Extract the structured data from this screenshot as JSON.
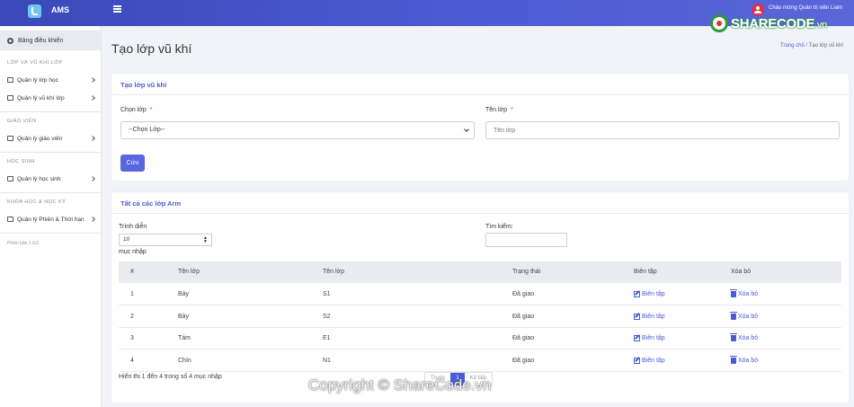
{
  "header": {
    "brand": "AMS",
    "welcome": "Chào mừng Quản trị viên Liam"
  },
  "sidebar": {
    "dashboard": "Bảng điều khiển",
    "sections": [
      {
        "title": "LỚP VÀ VŨ KHÍ LỚP",
        "items": [
          "Quản lý lớp học",
          "Quản lý vũ khí lớp"
        ]
      },
      {
        "title": "GIÁO VIÊN",
        "items": [
          "Quản lý giáo viên"
        ]
      },
      {
        "title": "HỌC SINH",
        "items": [
          "Quản lý học sinh"
        ]
      },
      {
        "title": "KHÓA HỌC & HỌC KỲ",
        "items": [
          "Quản lý Phiên & Thời hạn"
        ]
      }
    ],
    "version": "Phiên bản 1.0.0"
  },
  "page": {
    "title": "Tạo lớp vũ khí",
    "breadcrumb_home": "Trang chủ",
    "breadcrumb_sep": "/",
    "breadcrumb_current": "Tạo lớp vũ khí"
  },
  "form": {
    "heading": "Tạo lớp vũ khí",
    "select_label": "Chọn lớp",
    "required_mark": "*",
    "select_value": "--Chọn Lớp--",
    "name_label": "Tên lớp",
    "name_placeholder": "Tên lớp",
    "save_label": "Cứu"
  },
  "list": {
    "heading": "Tất cả các lớp Arm",
    "show_label": "Trình diễn",
    "page_length": "10",
    "entries_label": "mục nhập",
    "search_label": "Tìm kiếm:",
    "columns": [
      "#",
      "Tên lớp",
      "Tên lớp",
      "Trạng thái",
      "Biên tập",
      "Xóa bỏ"
    ],
    "rows": [
      {
        "no": "1",
        "class": "Bảy",
        "arm": "S1",
        "status": "Đã giao",
        "edit": "Biên tập",
        "delete": "Xóa bỏ"
      },
      {
        "no": "2",
        "class": "Bảy",
        "arm": "S2",
        "status": "Đã giao",
        "edit": "Biên tập",
        "delete": "Xóa bỏ"
      },
      {
        "no": "3",
        "class": "Tám",
        "arm": "E1",
        "status": "Đã giao",
        "edit": "Biên tập",
        "delete": "Xóa bỏ"
      },
      {
        "no": "4",
        "class": "Chín",
        "arm": "N1",
        "status": "Đã giao",
        "edit": "Biên tập",
        "delete": "Xóa bỏ"
      }
    ],
    "info": "Hiển thị 1 đến 4 trong số 4 mục nhập",
    "prev": "Trước",
    "current_page": "1",
    "next": "Kế tiếp"
  },
  "watermark": {
    "logo_main": "SHARECODE",
    "logo_suffix": ".vn",
    "copyright": "Copyright © ShareCode.vn"
  },
  "colors": {
    "accent": "#4b5bd4",
    "danger": "#d9344a"
  }
}
